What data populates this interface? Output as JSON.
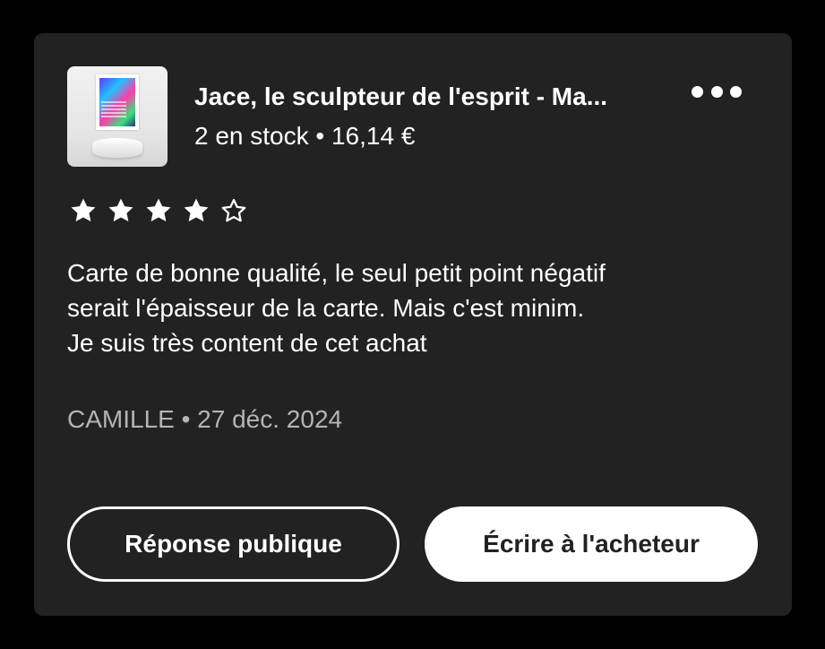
{
  "product": {
    "title": "Jace, le sculpteur de l'esprit - Ma...",
    "stock_price": "2 en stock • 16,14 €"
  },
  "rating": {
    "value": 4,
    "max": 5
  },
  "review": {
    "lines": [
      "Carte de bonne qualité, le seul petit point négatif",
      "serait l'épaisseur de la carte. Mais c'est minim.",
      "Je suis très content de cet achat"
    ]
  },
  "meta": {
    "author_date": "CAMILLE • 27 déc. 2024"
  },
  "actions": {
    "public_reply_label": "Réponse publique",
    "write_buyer_label": "Écrire à l'acheteur"
  },
  "icons": {
    "more": "more-horizontal-icon",
    "star_filled": "star-filled-icon",
    "star_outline": "star-outline-icon"
  },
  "colors": {
    "background": "#000000",
    "card": "#222222",
    "text": "#ffffff",
    "muted_text": "#b4b4b4"
  }
}
